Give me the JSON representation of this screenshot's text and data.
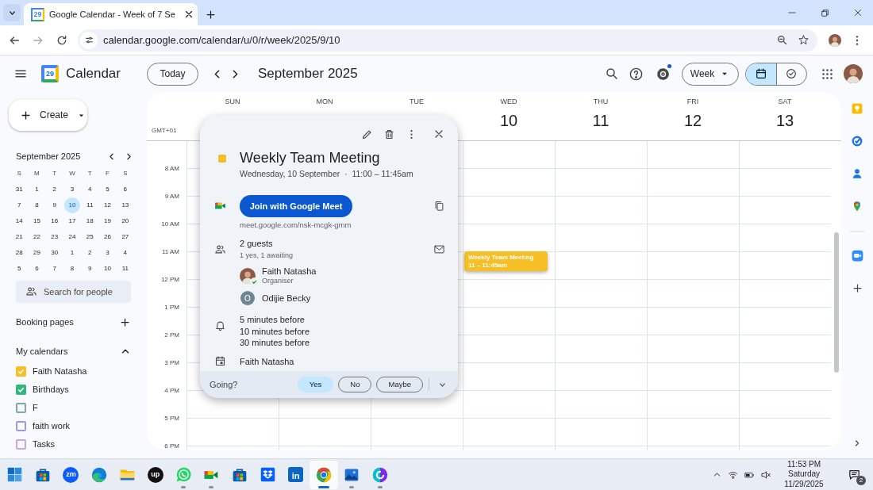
{
  "browser": {
    "tab": {
      "title": "Google Calendar - Week of 7 Se",
      "icon_text": "29"
    },
    "address": "calendar.google.com/calendar/u/0/r/week/2025/9/10"
  },
  "header": {
    "logo_text": "29",
    "app_name": "Calendar",
    "today_button": "Today",
    "period": "September 2025",
    "settings_badge": true,
    "view": "Week",
    "modes": [
      {
        "kind": "calendar",
        "selected": true
      },
      {
        "kind": "tasks",
        "selected": false
      }
    ]
  },
  "sidebar": {
    "create": "Create",
    "mini_calendar": {
      "title": "September 2025",
      "weekdays": [
        "S",
        "M",
        "T",
        "W",
        "T",
        "F",
        "S"
      ],
      "weeks": [
        [
          {
            "day": "31",
            "selected": false
          },
          {
            "day": "1",
            "selected": false
          },
          {
            "day": "2",
            "selected": false
          },
          {
            "day": "3",
            "selected": false
          },
          {
            "day": "4",
            "selected": false
          },
          {
            "day": "5",
            "selected": false
          },
          {
            "day": "6",
            "selected": false
          }
        ],
        [
          {
            "day": "7",
            "selected": false
          },
          {
            "day": "8",
            "selected": false
          },
          {
            "day": "9",
            "selected": false
          },
          {
            "day": "10",
            "selected": true
          },
          {
            "day": "11",
            "selected": false
          },
          {
            "day": "12",
            "selected": false
          },
          {
            "day": "13",
            "selected": false
          }
        ],
        [
          {
            "day": "14",
            "selected": false
          },
          {
            "day": "15",
            "selected": false
          },
          {
            "day": "16",
            "selected": false
          },
          {
            "day": "17",
            "selected": false
          },
          {
            "day": "18",
            "selected": false
          },
          {
            "day": "19",
            "selected": false
          },
          {
            "day": "20",
            "selected": false
          }
        ],
        [
          {
            "day": "21",
            "selected": false
          },
          {
            "day": "22",
            "selected": false
          },
          {
            "day": "23",
            "selected": false
          },
          {
            "day": "24",
            "selected": false
          },
          {
            "day": "25",
            "selected": false
          },
          {
            "day": "26",
            "selected": false
          },
          {
            "day": "27",
            "selected": false
          }
        ],
        [
          {
            "day": "28",
            "selected": false
          },
          {
            "day": "29",
            "selected": false
          },
          {
            "day": "30",
            "selected": false
          },
          {
            "day": "1",
            "selected": false
          },
          {
            "day": "2",
            "selected": false
          },
          {
            "day": "3",
            "selected": false
          },
          {
            "day": "4",
            "selected": false
          }
        ],
        [
          {
            "day": "5",
            "selected": false
          },
          {
            "day": "6",
            "selected": false
          },
          {
            "day": "7",
            "selected": false
          },
          {
            "day": "8",
            "selected": false
          },
          {
            "day": "9",
            "selected": false
          },
          {
            "day": "10",
            "selected": false
          },
          {
            "day": "11",
            "selected": false
          }
        ]
      ]
    },
    "people_search": {
      "placeholder": "Search for people"
    },
    "booking_pages": "Booking pages",
    "my_calendars": {
      "title": "My calendars",
      "expanded": true,
      "items": [
        {
          "name": "Faith Natasha",
          "color": "#f6bf26",
          "checked": true
        },
        {
          "name": "Birthdays",
          "color": "#33b679",
          "checked": true
        },
        {
          "name": "F",
          "color": "#7fa9a0",
          "checked": false
        },
        {
          "name": "faith work",
          "color": "#9e9bd9",
          "checked": false
        },
        {
          "name": "Tasks",
          "color": "#c9a5e8",
          "checked": false
        }
      ]
    }
  },
  "week": {
    "timezone": "GMT+01",
    "days": [
      {
        "name": "SUN"
      },
      {
        "name": "MON"
      },
      {
        "name": "TUE"
      },
      {
        "name": "WED",
        "date": "10",
        "events": [
          {
            "title": "Weekly Team Meeting",
            "time": "11 – 11:45am",
            "color": "#f6bf26"
          }
        ]
      },
      {
        "name": "THU",
        "date": "11"
      },
      {
        "name": "FRI",
        "date": "12"
      },
      {
        "name": "SAT",
        "date": "13"
      }
    ],
    "hours": [
      "8 AM",
      "9 AM",
      "10 AM",
      "11 AM",
      "12 PM",
      "1 PM",
      "2 PM",
      "3 PM",
      "4 PM",
      "5 PM",
      "6 PM"
    ]
  },
  "event_popup": {
    "color": "#f6bf26",
    "title": "Weekly Team Meeting",
    "when": "Wednesday, 10 September  ·  11:00 – 11:45am",
    "join_button": "Join with Google Meet",
    "meet_link": "meet.google.com/nsk-mcgk-gmm",
    "guests": {
      "count": "2 guests",
      "summary": "1 yes, 1 awaiting",
      "list": [
        {
          "kind": "photo",
          "name": "Faith Natasha",
          "role": "Organiser",
          "accepted": true
        },
        {
          "kind": "initial",
          "initial": "O",
          "name": "Odijie Becky",
          "accepted": false
        }
      ]
    },
    "reminders": [
      "5 minutes before",
      "10 minutes before",
      "30 minutes before"
    ],
    "calendar": "Faith Natasha",
    "rsvp": {
      "label": "Going?",
      "options": [
        {
          "label": "Yes",
          "selected": true
        },
        {
          "label": "No",
          "selected": false
        },
        {
          "label": "Maybe",
          "selected": false
        }
      ]
    }
  },
  "taskbar": {
    "apps": [
      {
        "kind": "start",
        "running": false,
        "selected": false
      },
      {
        "kind": "store",
        "running": false,
        "selected": false
      },
      {
        "kind": "zoom",
        "text": "zm",
        "running": false,
        "selected": false
      },
      {
        "kind": "edge",
        "running": false,
        "selected": false
      },
      {
        "kind": "explorer",
        "running": false,
        "selected": false
      },
      {
        "kind": "upwork",
        "text": "up",
        "running": false,
        "selected": false
      },
      {
        "kind": "whatsapp",
        "running": true,
        "selected": false
      },
      {
        "kind": "meet",
        "running": true,
        "selected": false
      },
      {
        "kind": "store",
        "running": false,
        "selected": false
      },
      {
        "kind": "dropbox",
        "running": false,
        "selected": false
      },
      {
        "kind": "linkedin",
        "text": "in",
        "running": false,
        "selected": false
      },
      {
        "kind": "chrome",
        "running": true,
        "selected": true
      },
      {
        "kind": "photos",
        "running": true,
        "selected": false
      },
      {
        "kind": "canva",
        "running": true,
        "selected": false
      }
    ],
    "clock": {
      "time": "11:53 PM",
      "day": "Saturday",
      "date": "11/29/2025"
    },
    "notifications": "2"
  }
}
